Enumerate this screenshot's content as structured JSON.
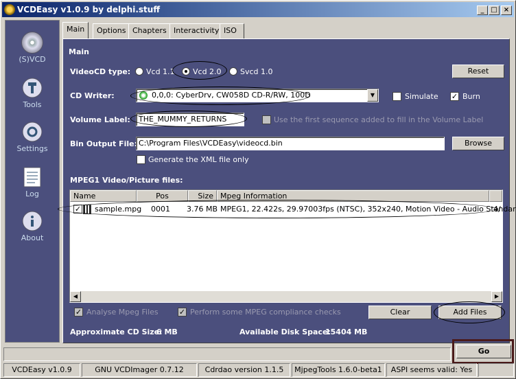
{
  "window": {
    "title": "VCDEasy v1.0.9 by delphi.stuff",
    "minimize": "_",
    "maximize": "□",
    "close": "×"
  },
  "sidebar": {
    "items": [
      {
        "label": "(S)VCD",
        "icon": "cd-icon"
      },
      {
        "label": "Tools",
        "icon": "tools-icon"
      },
      {
        "label": "Settings",
        "icon": "settings-icon"
      },
      {
        "label": "Log",
        "icon": "log-icon"
      },
      {
        "label": "About",
        "icon": "about-icon"
      }
    ]
  },
  "tabs": [
    "Main",
    "Options",
    "Chapters",
    "Interactivity",
    "ISO Files"
  ],
  "main": {
    "section_title": "Main",
    "videocd_type_label": "VideoCD type:",
    "types": [
      "Vcd 1.1",
      "Vcd 2.0",
      "Svcd 1.0"
    ],
    "selected_type": "Vcd 2.0",
    "reset_label": "Reset",
    "cd_writer_label": "CD Writer:",
    "cd_writer_value": "0,0,0: CyberDrv, CW058D CD-R/RW, 100D",
    "simulate_label": "Simulate",
    "burn_label": "Burn",
    "check_mark": "✓",
    "volume_label_label": "Volume Label:",
    "volume_label_value": "THE_MUMMY_RETURNS",
    "use_first_sequence_label": "Use the first sequence added to fill in the Volume Label",
    "bin_output_label": "Bin Output File:",
    "bin_output_value": "C:\\Program Files\\VCDEasy\\videocd.bin",
    "browse_label": "Browse",
    "generate_xml_label": "Generate the XML file only",
    "mpeg_files_label": "MPEG1 Video/Picture files:",
    "columns": [
      "Name",
      "Pos",
      "Size",
      "Mpeg Information"
    ],
    "files": [
      {
        "name": "sample.mpg",
        "pos": "0001",
        "size": "3.76 MB",
        "info": "MPEG1, 22.422s, 29.97003fps (NTSC), 352x240, Motion Video - Audio Standard",
        "extra": "4/"
      }
    ],
    "analyse_label": "Analyse Mpeg Files",
    "compliance_label": "Perform some MPEG compliance checks",
    "clear_label": "Clear",
    "add_files_label": "Add Files",
    "approx_size_label": "Approximate CD Size:",
    "approx_size_value": "6 MB",
    "disk_space_label": "Available Disk Space:",
    "disk_space_value": "15404 MB"
  },
  "go_label": "Go",
  "statusbar": [
    "VCDEasy v1.0.9",
    "GNU VCDImager 0.7.12",
    "Cdrdao version 1.1.5",
    "MjpegTools 1.6.0-beta1",
    "ASPI seems valid: Yes"
  ]
}
